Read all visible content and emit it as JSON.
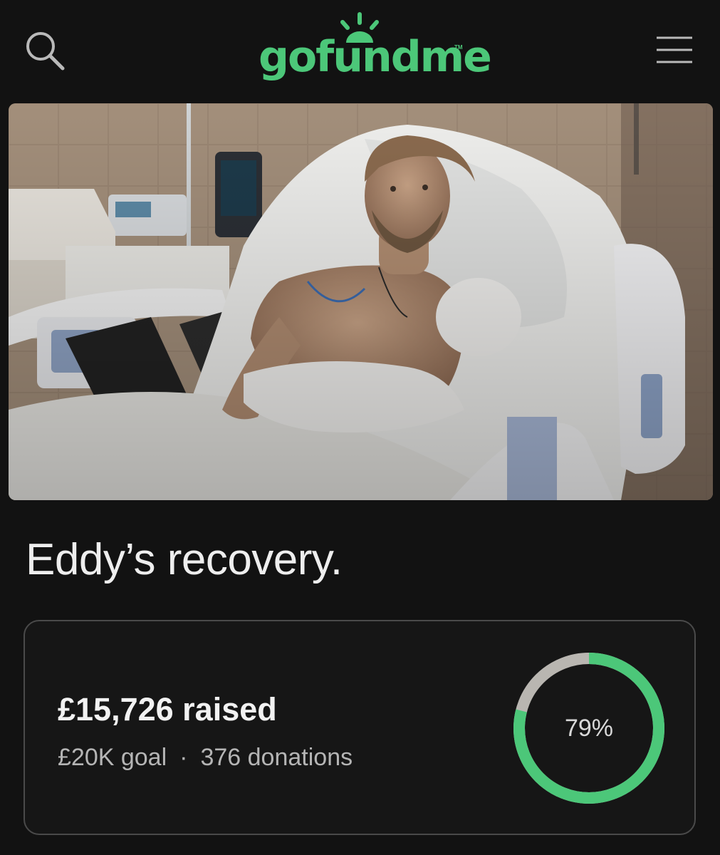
{
  "header": {
    "logo_text": "gofundme",
    "logo_tm": "TM",
    "search_icon": "search-icon",
    "menu_icon": "hamburger-menu-icon"
  },
  "hero_image": {
    "alt": "Patient in hospital bed"
  },
  "campaign": {
    "title": "Eddy’s recovery."
  },
  "stats": {
    "raised": "£15,726 raised",
    "goal": "£20K goal",
    "separator": "·",
    "donations": "376 donations",
    "progress_label": "79%",
    "progress_value": 0.79
  },
  "colors": {
    "brand_green": "#4cc779",
    "background": "#121212",
    "ring_track": "#b9b6b1"
  }
}
